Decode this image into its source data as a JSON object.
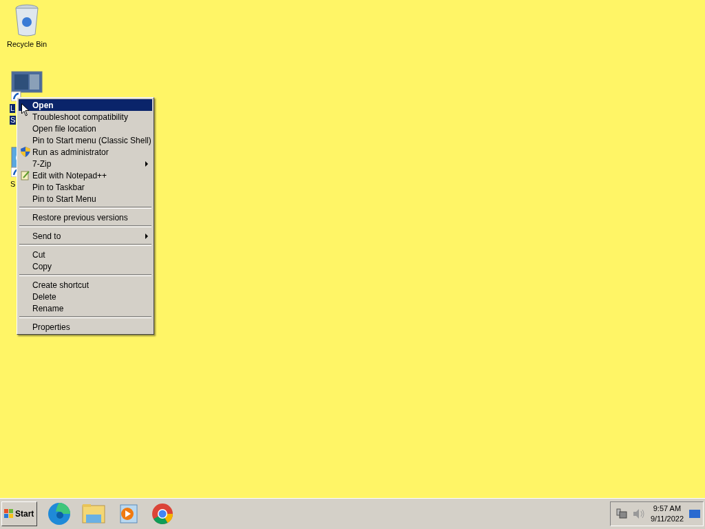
{
  "desktop_icons": [
    {
      "kind": "recycle",
      "label_lines": [
        "Recycle Bin"
      ],
      "selected": false
    },
    {
      "kind": "shortcut",
      "label_lines": [
        "L",
        "S"
      ],
      "selected": true
    },
    {
      "kind": "shortcut2",
      "label_lines": [
        "S"
      ],
      "selected": false
    }
  ],
  "context_menu": {
    "groups": [
      [
        {
          "label": "Open",
          "selected": true,
          "kind": "plain"
        },
        {
          "label": "Troubleshoot compatibility",
          "selected": false,
          "kind": "plain"
        },
        {
          "label": "Open file location",
          "selected": false,
          "kind": "plain"
        },
        {
          "label": "Pin to Start menu (Classic Shell)",
          "selected": false,
          "kind": "plain"
        },
        {
          "label": "Run as administrator",
          "selected": false,
          "kind": "shield"
        },
        {
          "label": "7-Zip",
          "selected": false,
          "kind": "submenu"
        },
        {
          "label": "Edit with Notepad++",
          "selected": false,
          "kind": "notepad"
        },
        {
          "label": "Pin to Taskbar",
          "selected": false,
          "kind": "plain"
        },
        {
          "label": "Pin to Start Menu",
          "selected": false,
          "kind": "plain"
        }
      ],
      [
        {
          "label": "Restore previous versions",
          "selected": false,
          "kind": "plain"
        }
      ],
      [
        {
          "label": "Send to",
          "selected": false,
          "kind": "submenu"
        }
      ],
      [
        {
          "label": "Cut",
          "selected": false,
          "kind": "plain"
        },
        {
          "label": "Copy",
          "selected": false,
          "kind": "plain"
        }
      ],
      [
        {
          "label": "Create shortcut",
          "selected": false,
          "kind": "plain"
        },
        {
          "label": "Delete",
          "selected": false,
          "kind": "plain"
        },
        {
          "label": "Rename",
          "selected": false,
          "kind": "plain"
        }
      ],
      [
        {
          "label": "Properties",
          "selected": false,
          "kind": "plain"
        }
      ]
    ]
  },
  "taskbar": {
    "start_label": "Start",
    "apps": [
      {
        "kind": "edge"
      },
      {
        "kind": "explorer"
      },
      {
        "kind": "media"
      },
      {
        "kind": "chrome"
      }
    ],
    "clock": {
      "time": "9:57 AM",
      "date": "9/11/2022"
    }
  }
}
